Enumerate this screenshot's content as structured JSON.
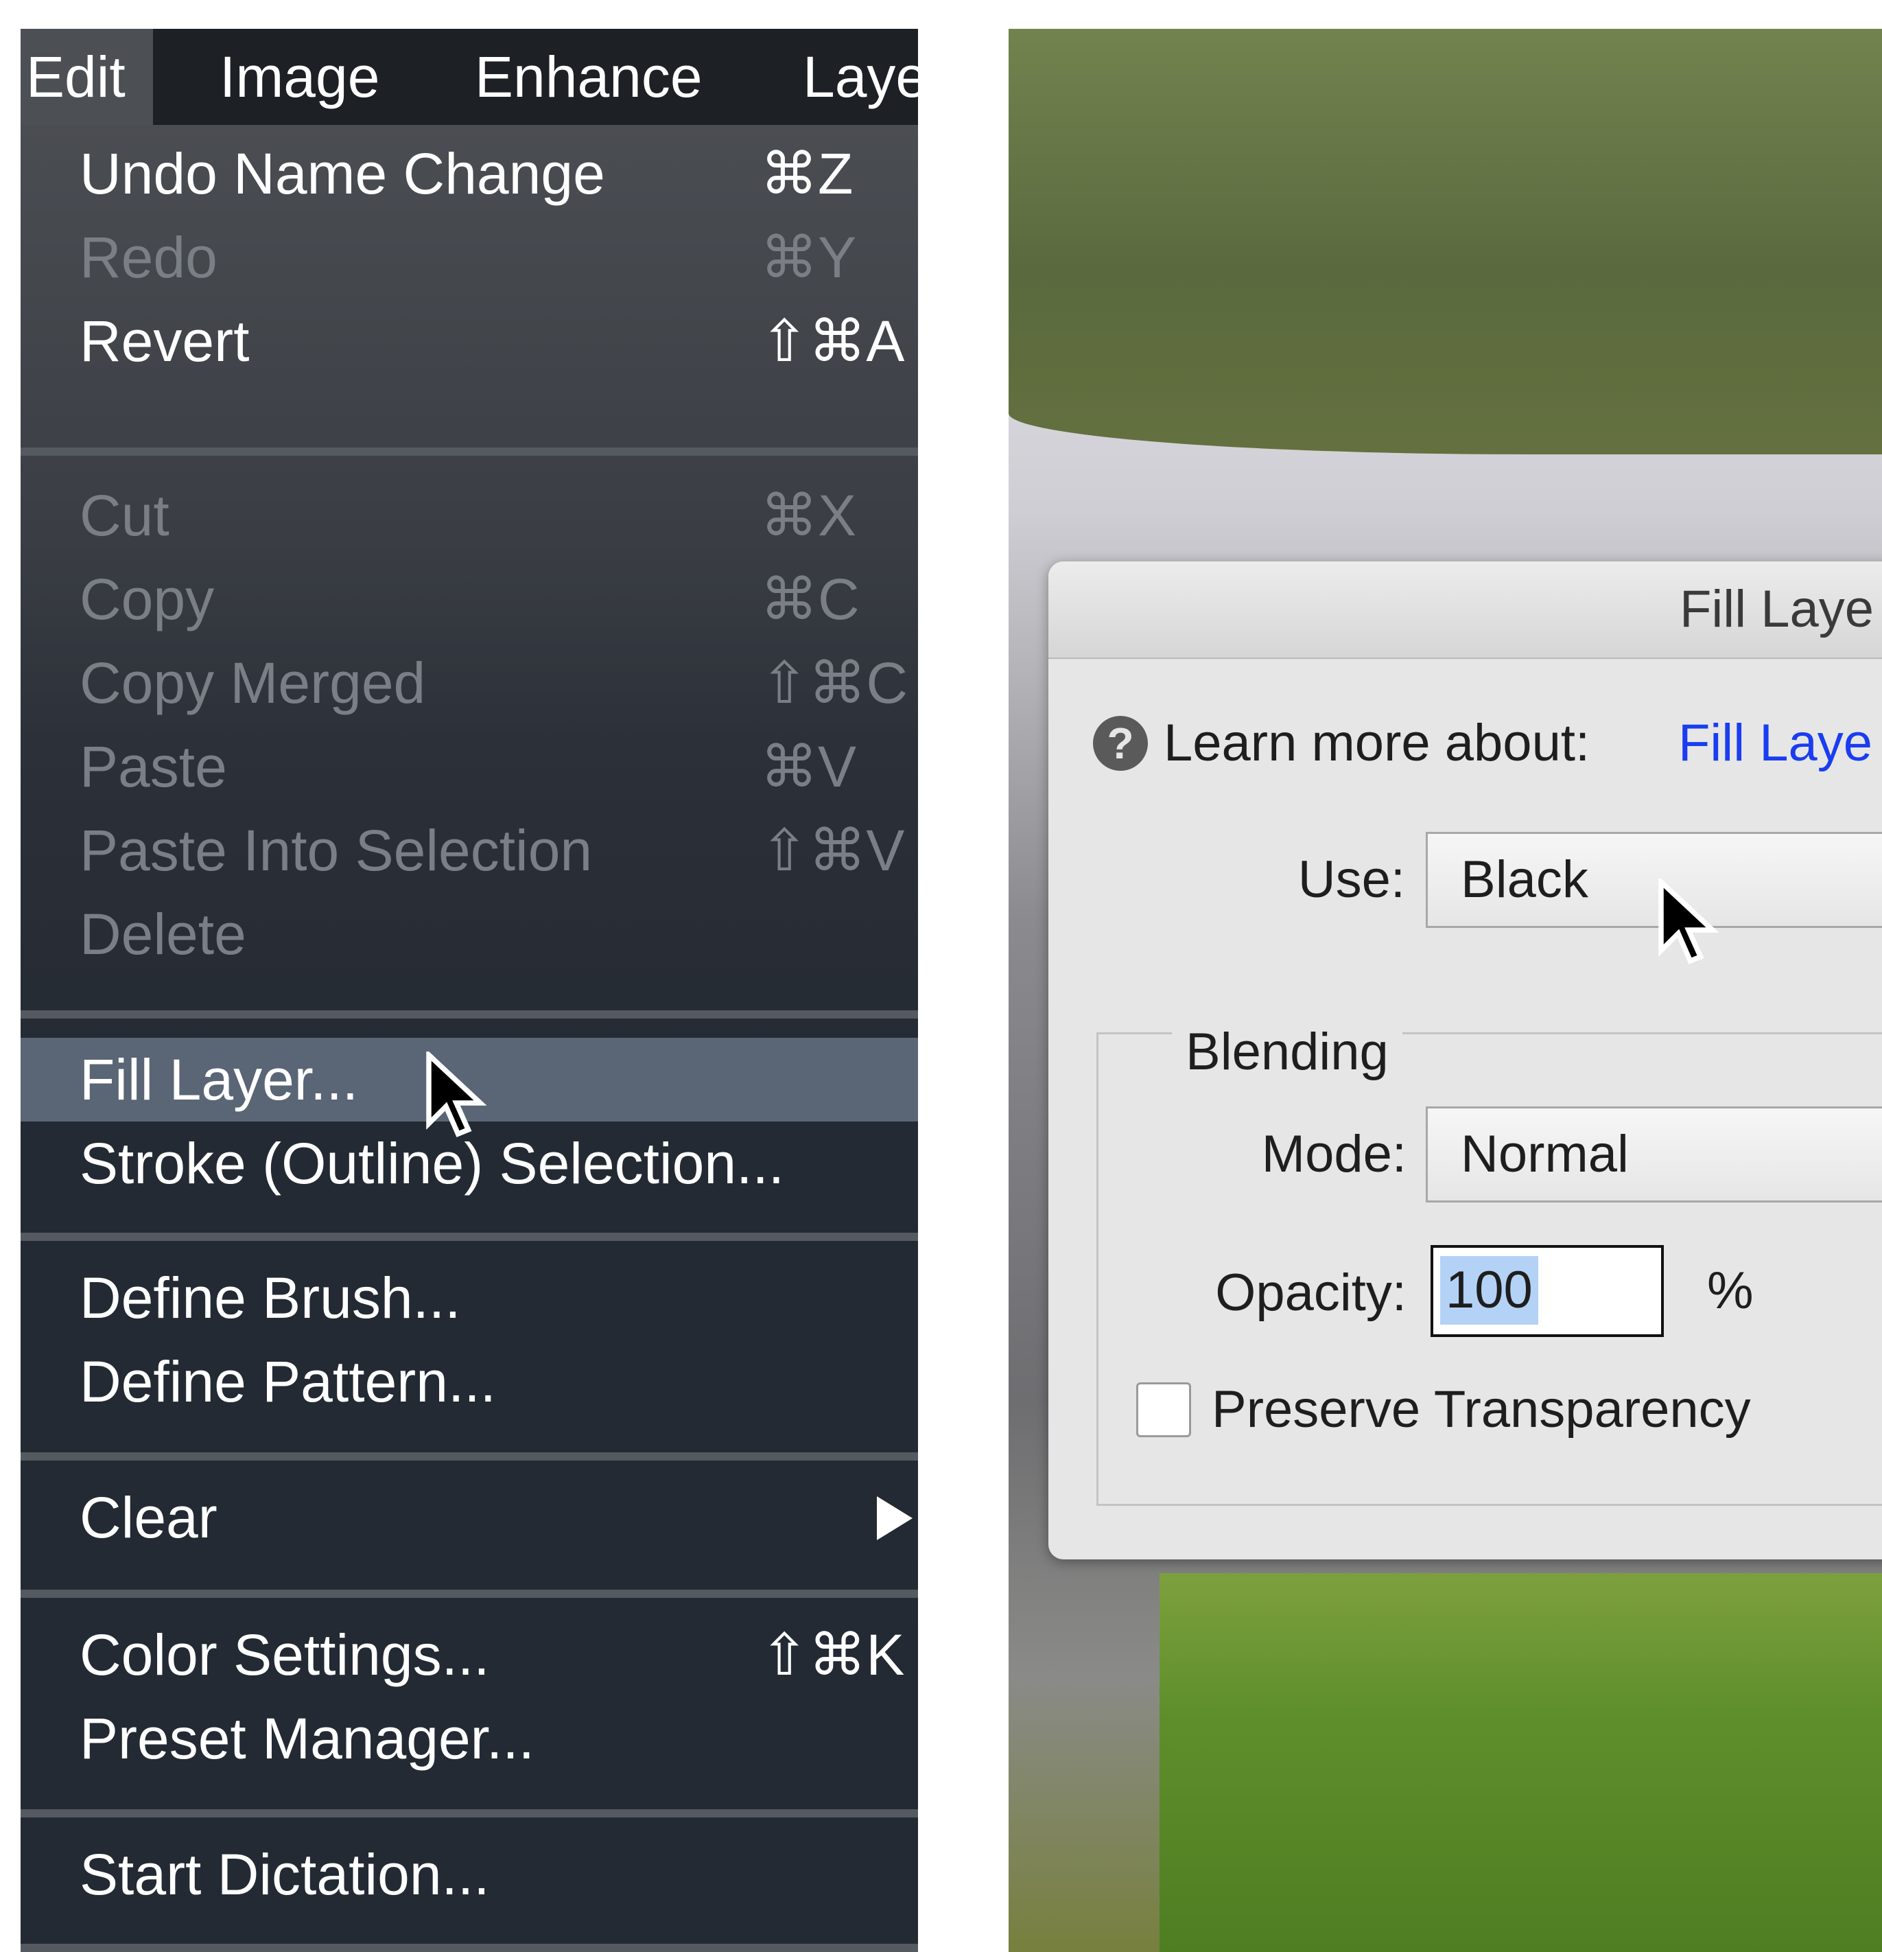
{
  "menubar": {
    "items": [
      "Edit",
      "Image",
      "Enhance",
      "Laye"
    ]
  },
  "edit_menu": {
    "undo": {
      "label": "Undo Name Change",
      "shortcut": "⌘Z"
    },
    "redo": {
      "label": "Redo",
      "shortcut": "⌘Y"
    },
    "revert": {
      "label": "Revert",
      "shortcut": "⇧⌘A"
    },
    "cut": {
      "label": "Cut",
      "shortcut": "⌘X"
    },
    "copy": {
      "label": "Copy",
      "shortcut": "⌘C"
    },
    "copy_merged": {
      "label": "Copy Merged",
      "shortcut": "⇧⌘C"
    },
    "paste": {
      "label": "Paste",
      "shortcut": "⌘V"
    },
    "paste_into": {
      "label": "Paste Into Selection",
      "shortcut": "⇧⌘V"
    },
    "delete": {
      "label": "Delete"
    },
    "fill_layer": {
      "label": "Fill Layer..."
    },
    "stroke": {
      "label": "Stroke (Outline) Selection..."
    },
    "define_brush": {
      "label": "Define Brush..."
    },
    "define_pattern": {
      "label": "Define Pattern..."
    },
    "clear": {
      "label": "Clear"
    },
    "color_settings": {
      "label": "Color Settings...",
      "shortcut": "⇧⌘K"
    },
    "preset_manager": {
      "label": "Preset Manager..."
    },
    "start_dictation": {
      "label": "Start Dictation..."
    }
  },
  "dialog": {
    "title": "Fill Laye",
    "learn_prefix": "Learn more about:",
    "learn_link": "Fill Laye",
    "use_label": "Use:",
    "use_value": "Black",
    "blending_legend": "Blending",
    "mode_label": "Mode:",
    "mode_value": "Normal",
    "opacity_label": "Opacity:",
    "opacity_value": "100",
    "opacity_unit": "%",
    "preserve_label": "Preserve Transparency",
    "preserve_checked": false
  },
  "colors": {
    "menu_bg": "#262b33",
    "menu_highlight": "#5a6575",
    "link_blue": "#1a3df0",
    "dialog_bg": "#e6e6e6"
  },
  "icons": [
    "submenu-arrow-icon",
    "mouse-cursor-icon",
    "help-icon"
  ]
}
